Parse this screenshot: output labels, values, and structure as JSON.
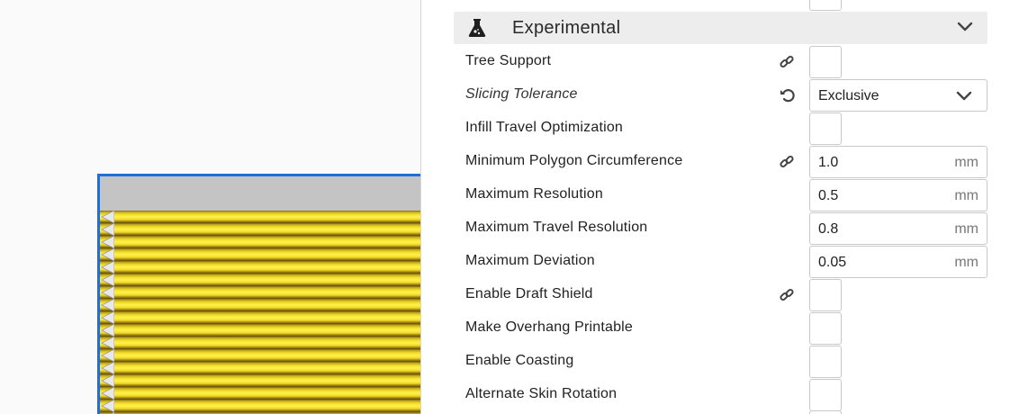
{
  "section": {
    "title": "Experimental",
    "icon": "flask-icon"
  },
  "rows": [
    {
      "label": "Tree Support",
      "control": "checkbox",
      "icon": "link-icon"
    },
    {
      "label": "Slicing Tolerance",
      "control": "dropdown",
      "value": "Exclusive",
      "icon": "reset-icon"
    },
    {
      "label": "Infill Travel Optimization",
      "control": "checkbox"
    },
    {
      "label": "Minimum Polygon Circumference",
      "control": "text",
      "value": "1.0",
      "unit": "mm",
      "icon": "link-icon"
    },
    {
      "label": "Maximum Resolution",
      "control": "text",
      "value": "0.5",
      "unit": "mm"
    },
    {
      "label": "Maximum Travel Resolution",
      "control": "text",
      "value": "0.8",
      "unit": "mm"
    },
    {
      "label": "Maximum Deviation",
      "control": "text",
      "value": "0.05",
      "unit": "mm"
    },
    {
      "label": "Enable Draft Shield",
      "control": "checkbox",
      "icon": "link-icon"
    },
    {
      "label": "Make Overhang Printable",
      "control": "checkbox"
    },
    {
      "label": "Enable Coasting",
      "control": "checkbox"
    },
    {
      "label": "Alternate Skin Rotation",
      "control": "checkbox"
    }
  ],
  "colors": {
    "selection_outline": "#1e6fd9",
    "layer_yellow": "#fff34a",
    "header_bg": "#ededed"
  }
}
